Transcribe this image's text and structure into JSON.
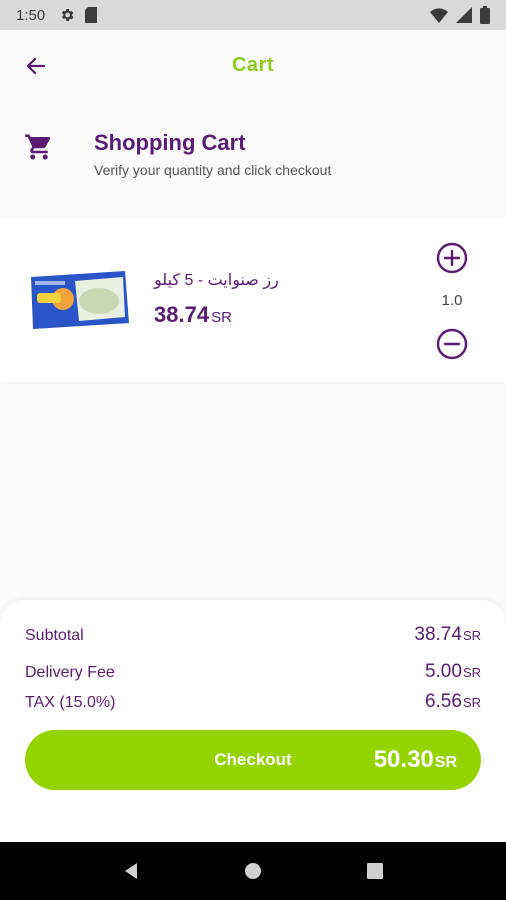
{
  "status": {
    "time": "1:50"
  },
  "appbar": {
    "title": "Cart"
  },
  "header": {
    "title": "Shopping Cart",
    "subtitle": "Verify your quantity and click checkout"
  },
  "cart": {
    "items": [
      {
        "name": "رز صنوايت - 5 كيلو",
        "price": "38.74",
        "currency": "SR",
        "quantity": "1.0"
      }
    ]
  },
  "summary": {
    "subtotal_label": "Subtotal",
    "subtotal_value": "38.74",
    "subtotal_currency": "SR",
    "delivery_label": "Delivery Fee",
    "delivery_value": "5.00",
    "delivery_currency": "SR",
    "tax_label": "TAX (15.0%)",
    "tax_value": "6.56",
    "tax_currency": "SR"
  },
  "checkout": {
    "label": "Checkout",
    "total": "50.30",
    "currency": "SR"
  },
  "colors": {
    "accent_green": "#93d400",
    "title_green": "#8ccc1a",
    "brand_purple": "#5b1b74"
  },
  "icons": {
    "back": "arrow-back-icon",
    "cart": "shopping-cart-icon",
    "plus": "plus-circle-icon",
    "minus": "minus-circle-icon"
  }
}
